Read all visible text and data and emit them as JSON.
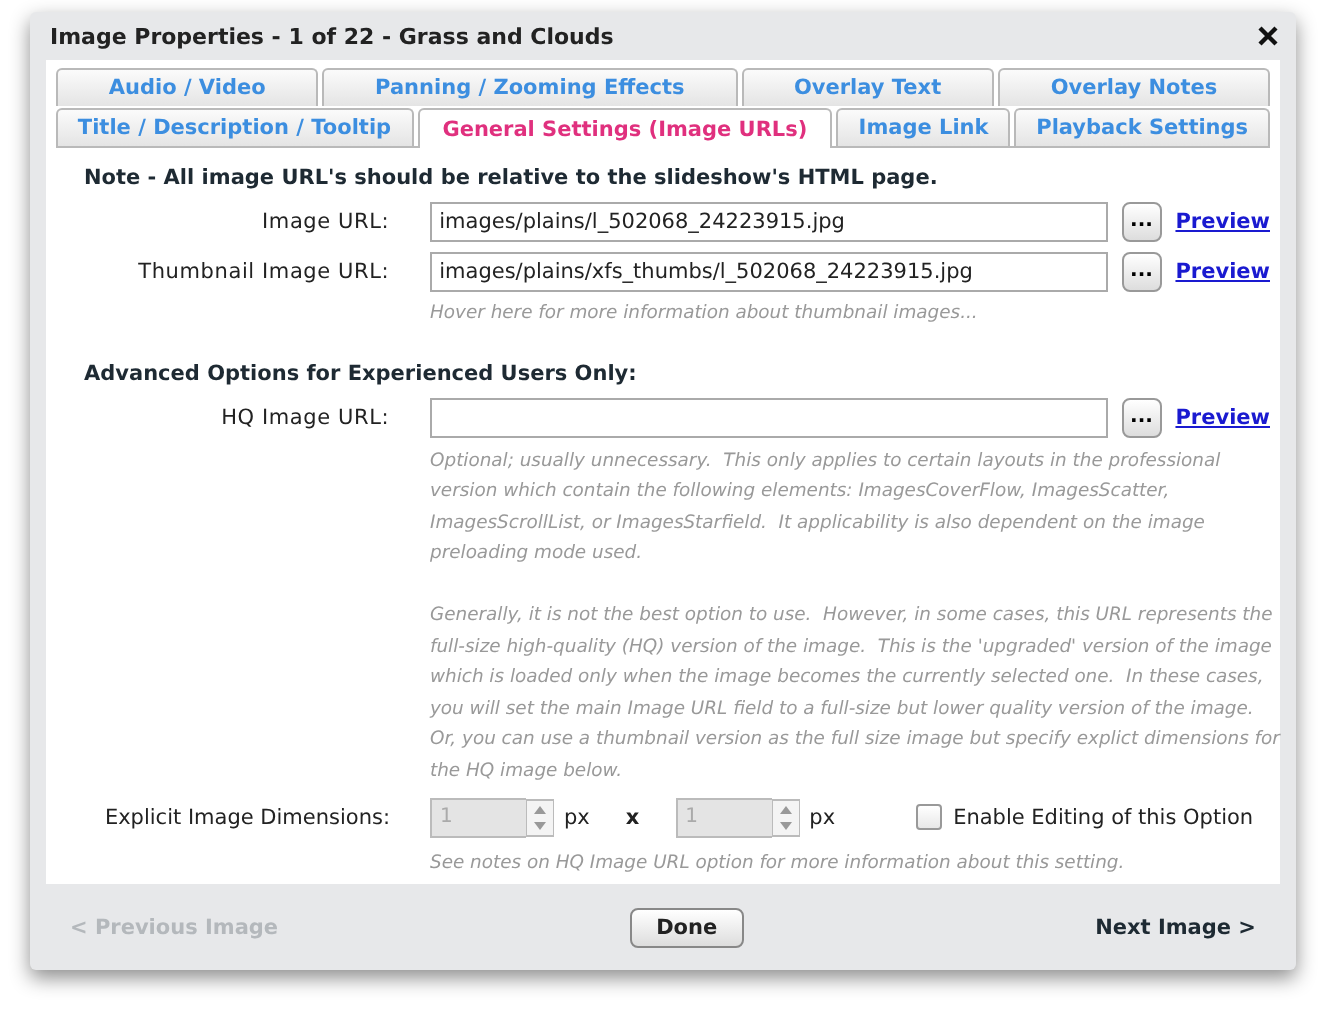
{
  "window": {
    "title": "Image Properties - 1 of 22 - Grass and Clouds"
  },
  "tab_rows": [
    {
      "tabs": [
        {
          "label": "Audio / Video",
          "selected": false
        },
        {
          "label": "Panning / Zooming Effects",
          "selected": false
        },
        {
          "label": "Overlay Text",
          "selected": false
        },
        {
          "label": "Overlay Notes",
          "selected": false
        }
      ]
    },
    {
      "tabs": [
        {
          "label": "Title / Description / Tooltip",
          "selected": false
        },
        {
          "label": "General Settings (Image URLs)",
          "selected": true
        },
        {
          "label": "Image Link",
          "selected": false
        },
        {
          "label": "Playback Settings",
          "selected": false
        }
      ]
    }
  ],
  "note": "Note - All image URL's should be relative to the slideshow's HTML page.",
  "url_fields": [
    {
      "label": "Image URL:",
      "value": "images/plains/l_502068_24223915.jpg",
      "browse": "...",
      "preview": "Preview"
    },
    {
      "label": "Thumbnail Image URL:",
      "value": "images/plains/xfs_thumbs/l_502068_24223915.jpg",
      "browse": "...",
      "preview": "Preview"
    }
  ],
  "thumbnail_hint": "Hover here for more information about thumbnail images...",
  "advanced_heading": "Advanced Options for Experienced Users Only:",
  "hq_field": {
    "label": "HQ Image URL:",
    "browse": "...",
    "preview": "Preview"
  },
  "hq_help": [
    "Optional; usually unnecessary.  This only applies to certain layouts in the professional version which contain the following elements: ImagesCoverFlow, ImagesScatter, ImagesScrollList, or ImagesStarfield.  It applicability is also dependent on the image preloading mode used.",
    "Generally, it is not the best option to use.  However, in some cases, this URL represents the full-size high-quality (HQ) version of the image.  This is the 'upgraded' version of the image which is loaded only when the image becomes the currently selected one.  In these cases, you will set the main Image URL field to a full-size but lower quality version of the image.  Or, you can use a thumbnail version as the full size image but specify explict dimensions for the HQ image below."
  ],
  "dimensions": {
    "label": "Explicit Image Dimensions:",
    "width": {
      "value": "1",
      "unit": "px",
      "disabled": true
    },
    "separator": "x",
    "height": {
      "value": "1",
      "unit": "px",
      "disabled": true
    },
    "enable": {
      "label": "Enable Editing of this Option",
      "checked": false
    },
    "note": "See notes on HQ Image URL option for more information about this setting."
  },
  "footer": {
    "previous": {
      "label": "< Previous Image",
      "disabled": true
    },
    "done": "Done",
    "next": {
      "label": "Next Image >",
      "disabled": false
    }
  }
}
